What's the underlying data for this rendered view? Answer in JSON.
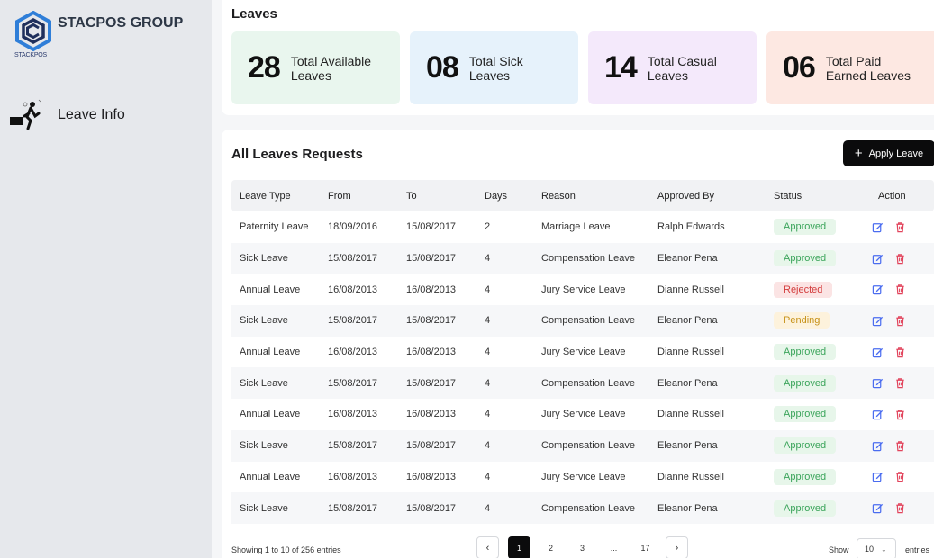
{
  "brand": {
    "name": "STACPOS GROUP",
    "logo_text": "STACKPOS"
  },
  "sidebar": {
    "items": [
      {
        "label": "Leave Info",
        "icon": "leave-person-icon"
      }
    ]
  },
  "leaves": {
    "title": "Leaves",
    "cards": [
      {
        "value": "28",
        "label": "Total Available Leaves",
        "color": "#e9f6ee"
      },
      {
        "value": "08",
        "label": "Total Sick Leaves",
        "color": "#e6f2fb"
      },
      {
        "value": "14",
        "label": "Total Casual Leaves",
        "color": "#f4e9fb"
      },
      {
        "value": "06",
        "label": "Total Paid Earned Leaves",
        "color": "#fde8e2"
      }
    ]
  },
  "requests": {
    "title": "All Leaves Requests",
    "apply_label": "Apply Leave",
    "columns": [
      "Leave Type",
      "From",
      "To",
      "Days",
      "Reason",
      "Approved By",
      "Status",
      "Action"
    ],
    "rows": [
      {
        "type": "Paternity Leave",
        "from": "18/09/2016",
        "to": "15/08/2017",
        "days": "2",
        "reason": "Marriage Leave",
        "approved_by": "Ralph Edwards",
        "status": "Approved"
      },
      {
        "type": "Sick Leave",
        "from": "15/08/2017",
        "to": "15/08/2017",
        "days": "4",
        "reason": "Compensation Leave",
        "approved_by": "Eleanor Pena",
        "status": "Approved"
      },
      {
        "type": "Annual Leave",
        "from": "16/08/2013",
        "to": "16/08/2013",
        "days": "4",
        "reason": "Jury Service Leave",
        "approved_by": "Dianne Russell",
        "status": "Rejected"
      },
      {
        "type": "Sick Leave",
        "from": "15/08/2017",
        "to": "15/08/2017",
        "days": "4",
        "reason": "Compensation Leave",
        "approved_by": "Eleanor Pena",
        "status": "Pending"
      },
      {
        "type": "Annual Leave",
        "from": "16/08/2013",
        "to": "16/08/2013",
        "days": "4",
        "reason": "Jury Service Leave",
        "approved_by": "Dianne Russell",
        "status": "Approved"
      },
      {
        "type": "Sick Leave",
        "from": "15/08/2017",
        "to": "15/08/2017",
        "days": "4",
        "reason": "Compensation Leave",
        "approved_by": "Eleanor Pena",
        "status": "Approved"
      },
      {
        "type": "Annual Leave",
        "from": "16/08/2013",
        "to": "16/08/2013",
        "days": "4",
        "reason": "Jury Service Leave",
        "approved_by": "Dianne Russell",
        "status": "Approved"
      },
      {
        "type": "Sick Leave",
        "from": "15/08/2017",
        "to": "15/08/2017",
        "days": "4",
        "reason": "Compensation Leave",
        "approved_by": "Eleanor Pena",
        "status": "Approved"
      },
      {
        "type": "Annual Leave",
        "from": "16/08/2013",
        "to": "16/08/2013",
        "days": "4",
        "reason": "Jury Service Leave",
        "approved_by": "Dianne Russell",
        "status": "Approved"
      },
      {
        "type": "Sick Leave",
        "from": "15/08/2017",
        "to": "15/08/2017",
        "days": "4",
        "reason": "Compensation Leave",
        "approved_by": "Eleanor Pena",
        "status": "Approved"
      }
    ],
    "action_icons": [
      "edit-icon",
      "delete-icon"
    ],
    "status_colors": {
      "Approved": "#3aa45a",
      "Rejected": "#d33c3c",
      "Pending": "#c79219"
    }
  },
  "footer": {
    "showing": "Showing 1 to 10 of 256 entries",
    "pages": [
      "1",
      "2",
      "3",
      "...",
      "17"
    ],
    "current_page": "1",
    "show_label": "Show",
    "entries_value": "10",
    "entries_label": "entries"
  }
}
